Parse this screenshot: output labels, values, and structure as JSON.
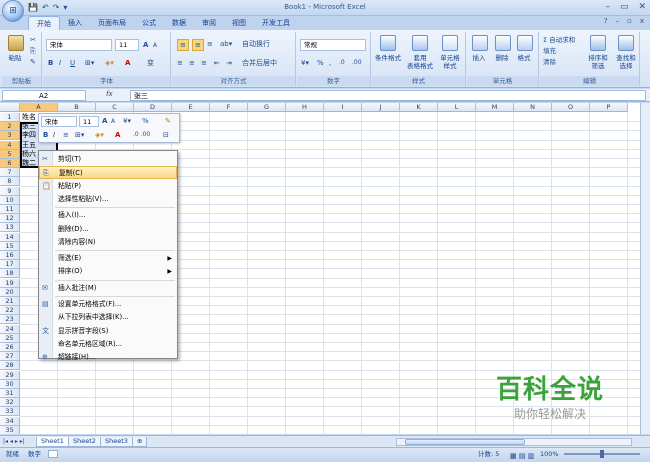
{
  "window": {
    "title": "Book1 - Microsoft Excel",
    "minimize": "–",
    "restore": "▭",
    "close": "✕"
  },
  "qat": {
    "save": "💾",
    "undo": "↶",
    "redo": "↷",
    "more": "▾"
  },
  "tabs": [
    "开始",
    "插入",
    "页面布局",
    "公式",
    "数据",
    "审阅",
    "视图",
    "开发工具"
  ],
  "ribbon_right_controls": {
    "help": "?",
    "min": "–",
    "restore": "▫",
    "close": "x"
  },
  "ribbon": {
    "clipboard": {
      "label": "剪贴板",
      "paste": "粘贴"
    },
    "font": {
      "label": "字体",
      "font_name": "宋体",
      "font_size": "11",
      "bold": "B",
      "italic": "I",
      "underline": "U",
      "grow": "A",
      "shrink": "A",
      "color_a": "A",
      "wen": "变"
    },
    "alignment": {
      "label": "对齐方式",
      "wrap": "自动换行",
      "merge": "合并后居中"
    },
    "number": {
      "label": "数字",
      "format": "常规",
      "currency": "%",
      "comma": ",",
      "inc": ".0",
      "dec": ".00"
    },
    "styles": {
      "label": "样式",
      "conditional": "条件格式",
      "table": "套用\n表格格式",
      "cell": "单元格\n样式"
    },
    "cells": {
      "label": "单元格",
      "insert": "插入",
      "delete": "删除",
      "format": "格式"
    },
    "editing": {
      "label": "编辑",
      "autosum": "Σ 自动求和",
      "fill": "填充",
      "clear": "清除",
      "sort": "排序和\n筛选",
      "find": "查找和\n选择"
    }
  },
  "formula_bar": {
    "name_box": "A2",
    "fx": "fx",
    "value": "张三"
  },
  "columns": [
    "A",
    "B",
    "C",
    "D",
    "E",
    "F",
    "G",
    "H",
    "I",
    "J",
    "K",
    "L",
    "M",
    "N",
    "O",
    "P"
  ],
  "rows": [
    "1",
    "2",
    "3",
    "4",
    "5",
    "6",
    "7",
    "8",
    "9",
    "10",
    "11",
    "12",
    "13",
    "14",
    "15",
    "16",
    "17",
    "18",
    "19",
    "20",
    "21",
    "22",
    "23",
    "24",
    "25",
    "26",
    "27",
    "28",
    "29",
    "30",
    "31",
    "32",
    "33",
    "34",
    "35",
    "36"
  ],
  "cells": {
    "A1": "姓名",
    "A2": "张三",
    "A3": "李四",
    "A4": "王五",
    "A5": "杨六",
    "A6": "魏二"
  },
  "mini_toolbar": {
    "font": "宋体",
    "size": "11",
    "grow": "A",
    "shrink": "A",
    "pct": "%",
    "bold": "B",
    "italic": "I",
    "align": "≡",
    "color": "A"
  },
  "context_menu": [
    {
      "label": "剪切(T)",
      "icon": "scissors-icon"
    },
    {
      "label": "复制(C)",
      "icon": "copy-icon",
      "highlight": true
    },
    {
      "label": "粘贴(P)",
      "icon": "paste-icon"
    },
    {
      "label": "选择性粘贴(V)..."
    },
    {
      "sep": true
    },
    {
      "label": "插入(I)..."
    },
    {
      "label": "删除(D)..."
    },
    {
      "label": "清除内容(N)"
    },
    {
      "sep": true
    },
    {
      "label": "筛选(E)",
      "submenu": true
    },
    {
      "label": "排序(O)",
      "submenu": true
    },
    {
      "sep": true
    },
    {
      "label": "插入批注(M)",
      "icon": "comment-icon"
    },
    {
      "sep": true
    },
    {
      "label": "设置单元格格式(F)...",
      "icon": "format-icon"
    },
    {
      "label": "从下拉列表中选择(K)..."
    },
    {
      "label": "显示拼音字段(S)",
      "icon": "pinyin-icon"
    },
    {
      "label": "命名单元格区域(R)..."
    },
    {
      "label": "超链接(H)...",
      "icon": "hyperlink-icon"
    }
  ],
  "sheets": [
    "Sheet1",
    "Sheet2",
    "Sheet3"
  ],
  "status": {
    "ready": "就绪",
    "digits": "数字",
    "count": "计数: 5",
    "zoom": "100%"
  },
  "watermark": {
    "title": "百科全说",
    "subtitle": "助你轻松解决"
  }
}
